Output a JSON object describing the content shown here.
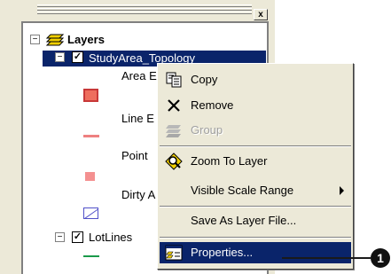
{
  "toc": {
    "close_glyph": "x",
    "root": {
      "label": "Layers",
      "expander": "−"
    },
    "layers": [
      {
        "name": "StudyArea_Topology",
        "expander": "−",
        "checkbox": "✓",
        "selected": true,
        "children": [
          {
            "label": "Area E",
            "symbol": "area-symbol"
          },
          {
            "label": "Line E",
            "symbol": "line-symbol"
          },
          {
            "label": "Point",
            "symbol": "point-symbol"
          },
          {
            "label": "Dirty A",
            "symbol": "dirty-area-symbol"
          }
        ]
      },
      {
        "name": "LotLines",
        "expander": "−",
        "checkbox": "✓",
        "selected": false
      }
    ]
  },
  "context_menu": {
    "items": [
      {
        "label": "Copy",
        "icon": "copy-icon",
        "enabled": true
      },
      {
        "label": "Remove",
        "icon": "remove-icon",
        "enabled": true
      },
      {
        "label": "Group",
        "icon": "group-icon",
        "enabled": false
      },
      {
        "label": "Zoom To Layer",
        "icon": "zoom-to-layer-icon",
        "enabled": true
      },
      {
        "label": "Visible Scale Range",
        "icon": "",
        "enabled": true,
        "submenu": true
      },
      {
        "label": "Save As Layer File...",
        "icon": "",
        "enabled": true
      },
      {
        "label": "Properties...",
        "icon": "properties-icon",
        "enabled": true,
        "highlighted": true
      }
    ]
  },
  "callout": {
    "number": "1"
  },
  "colors": {
    "selection": "#0a246a",
    "menu_background": "#ece9d8",
    "area_symbol": "#ee6e5e",
    "line_symbol": "#ee8080",
    "point_symbol": "#f49090",
    "dirty_symbol": "#5050c8",
    "lotline_symbol": "#1a9a4a"
  }
}
